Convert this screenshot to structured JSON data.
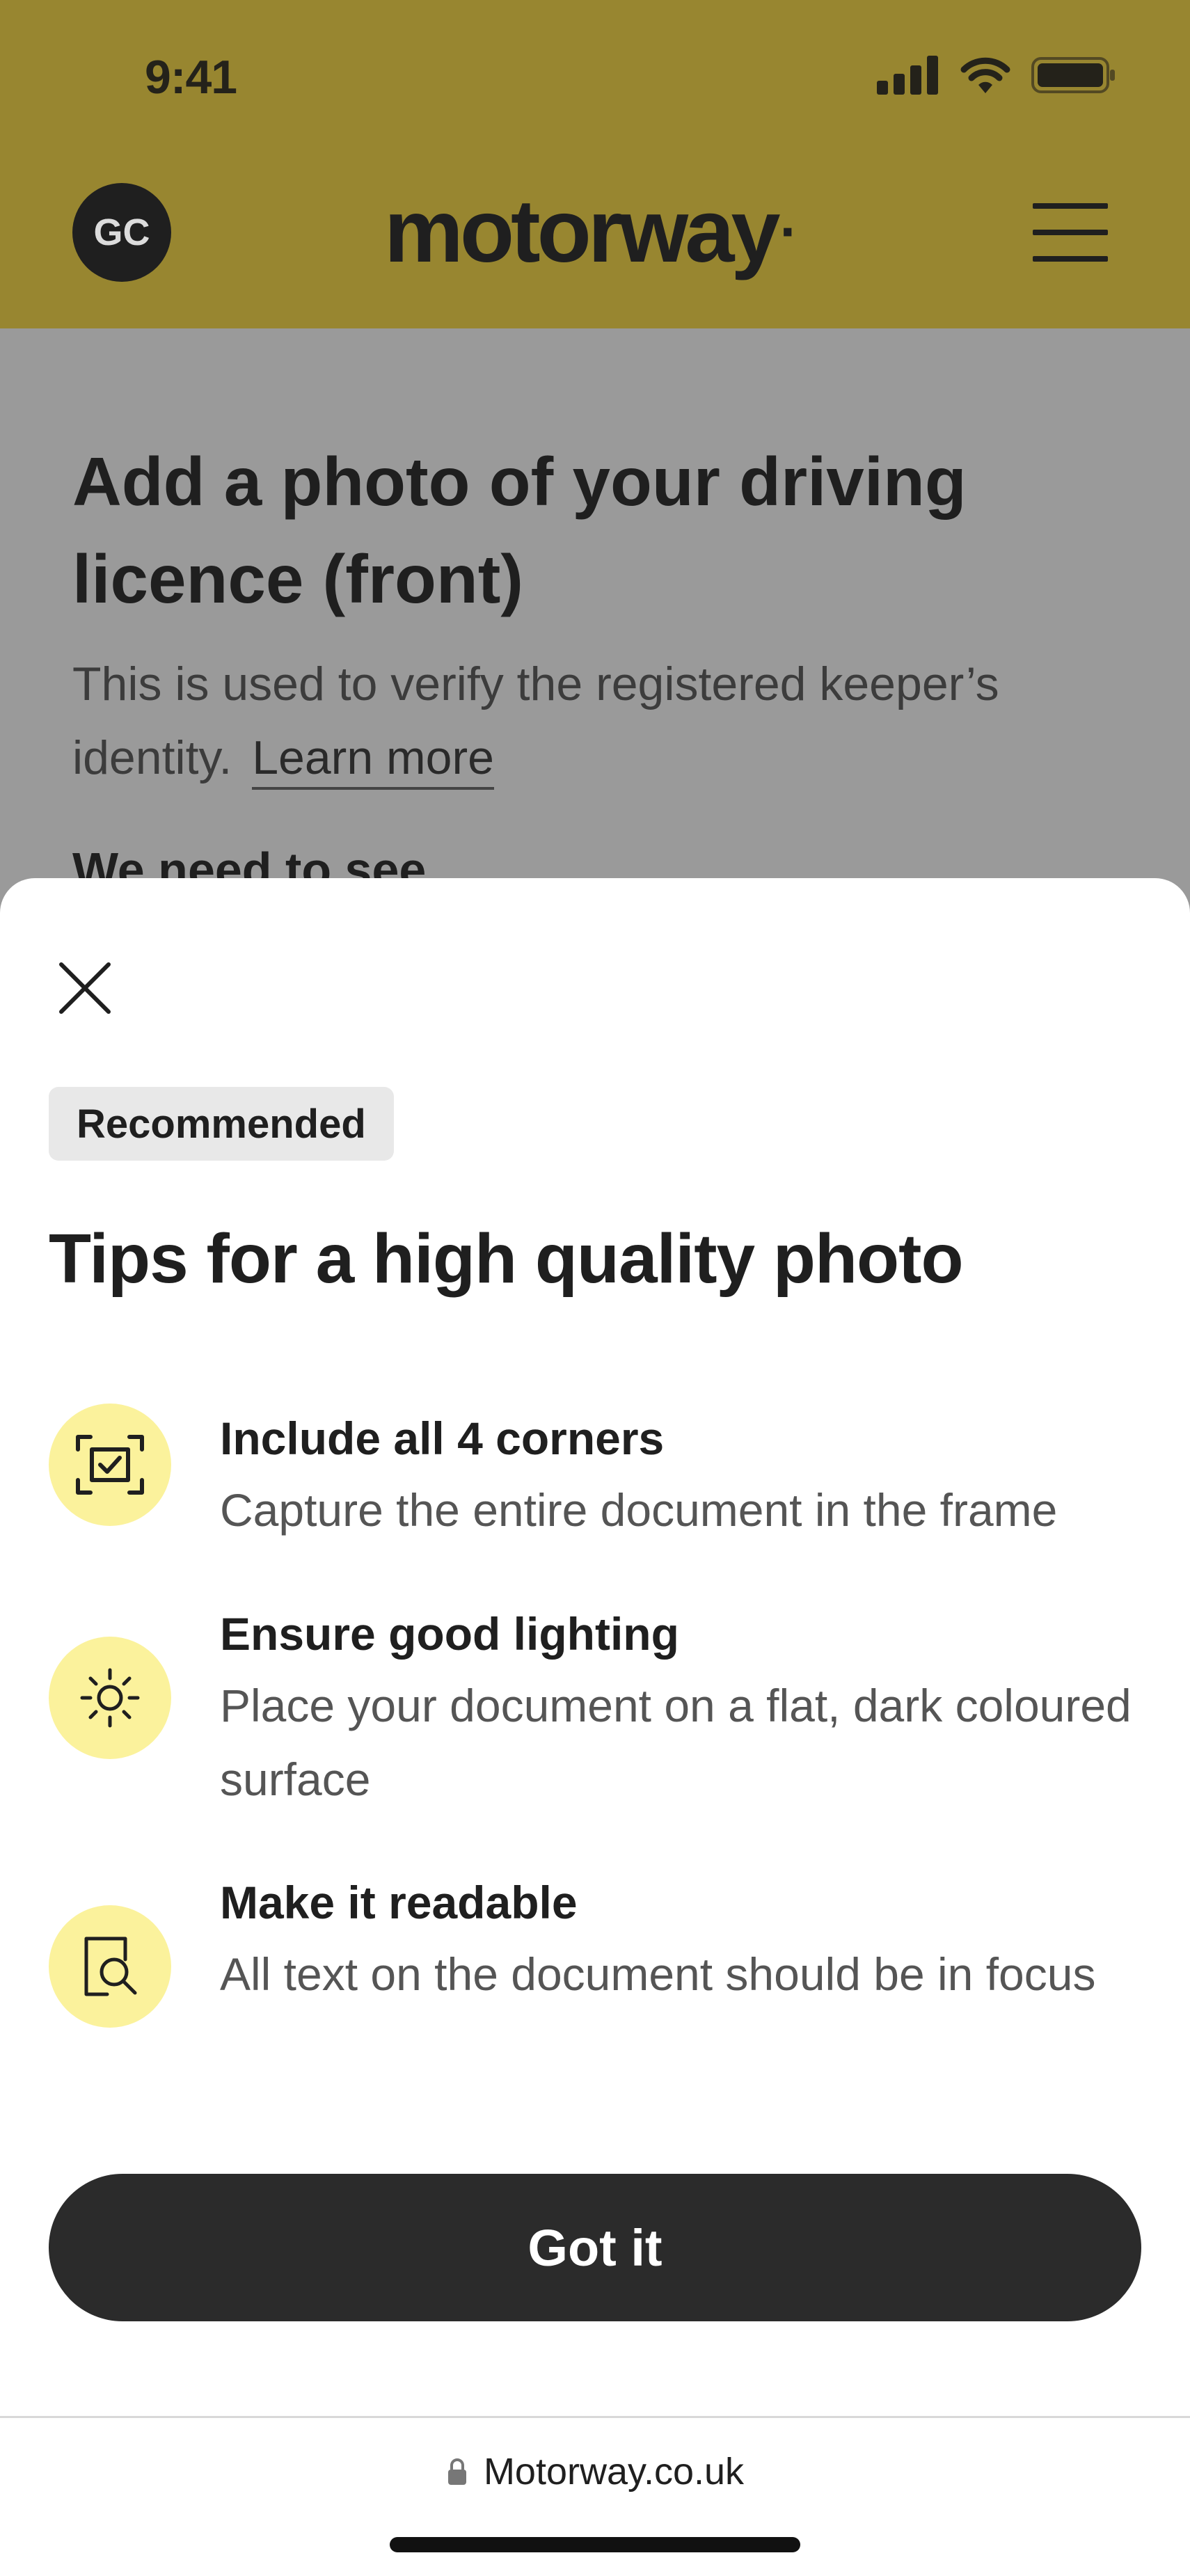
{
  "status_bar": {
    "time": "9:41"
  },
  "header": {
    "avatar_initials": "GC",
    "logo_text": "motorway",
    "logo_mark": "·"
  },
  "background_page": {
    "title": "Add a photo of your driving licence (front)",
    "description": "This is used to verify the registered keeper’s identity.",
    "learn_more_link": "Learn more",
    "section_heading": "We need to see"
  },
  "sheet": {
    "badge": "Recommended",
    "title": "Tips for a high quality photo",
    "tips": [
      {
        "icon": "frame-check-icon",
        "title": "Include all 4 corners",
        "desc": "Capture the entire document in the frame"
      },
      {
        "icon": "sun-icon",
        "title": "Ensure good lighting",
        "desc": "Place your document on a flat, dark coloured surface"
      },
      {
        "icon": "document-search-icon",
        "title": "Make it readable",
        "desc": "All text on the document should be in focus"
      }
    ],
    "primary_button": "Got it"
  },
  "browser": {
    "url": "Motorway.co.uk"
  },
  "colors": {
    "header_bg": "#988630",
    "overlay_bg": "#9a9a9a",
    "icon_circle": "#fbf29c",
    "button_bg": "#2b2b2b"
  }
}
